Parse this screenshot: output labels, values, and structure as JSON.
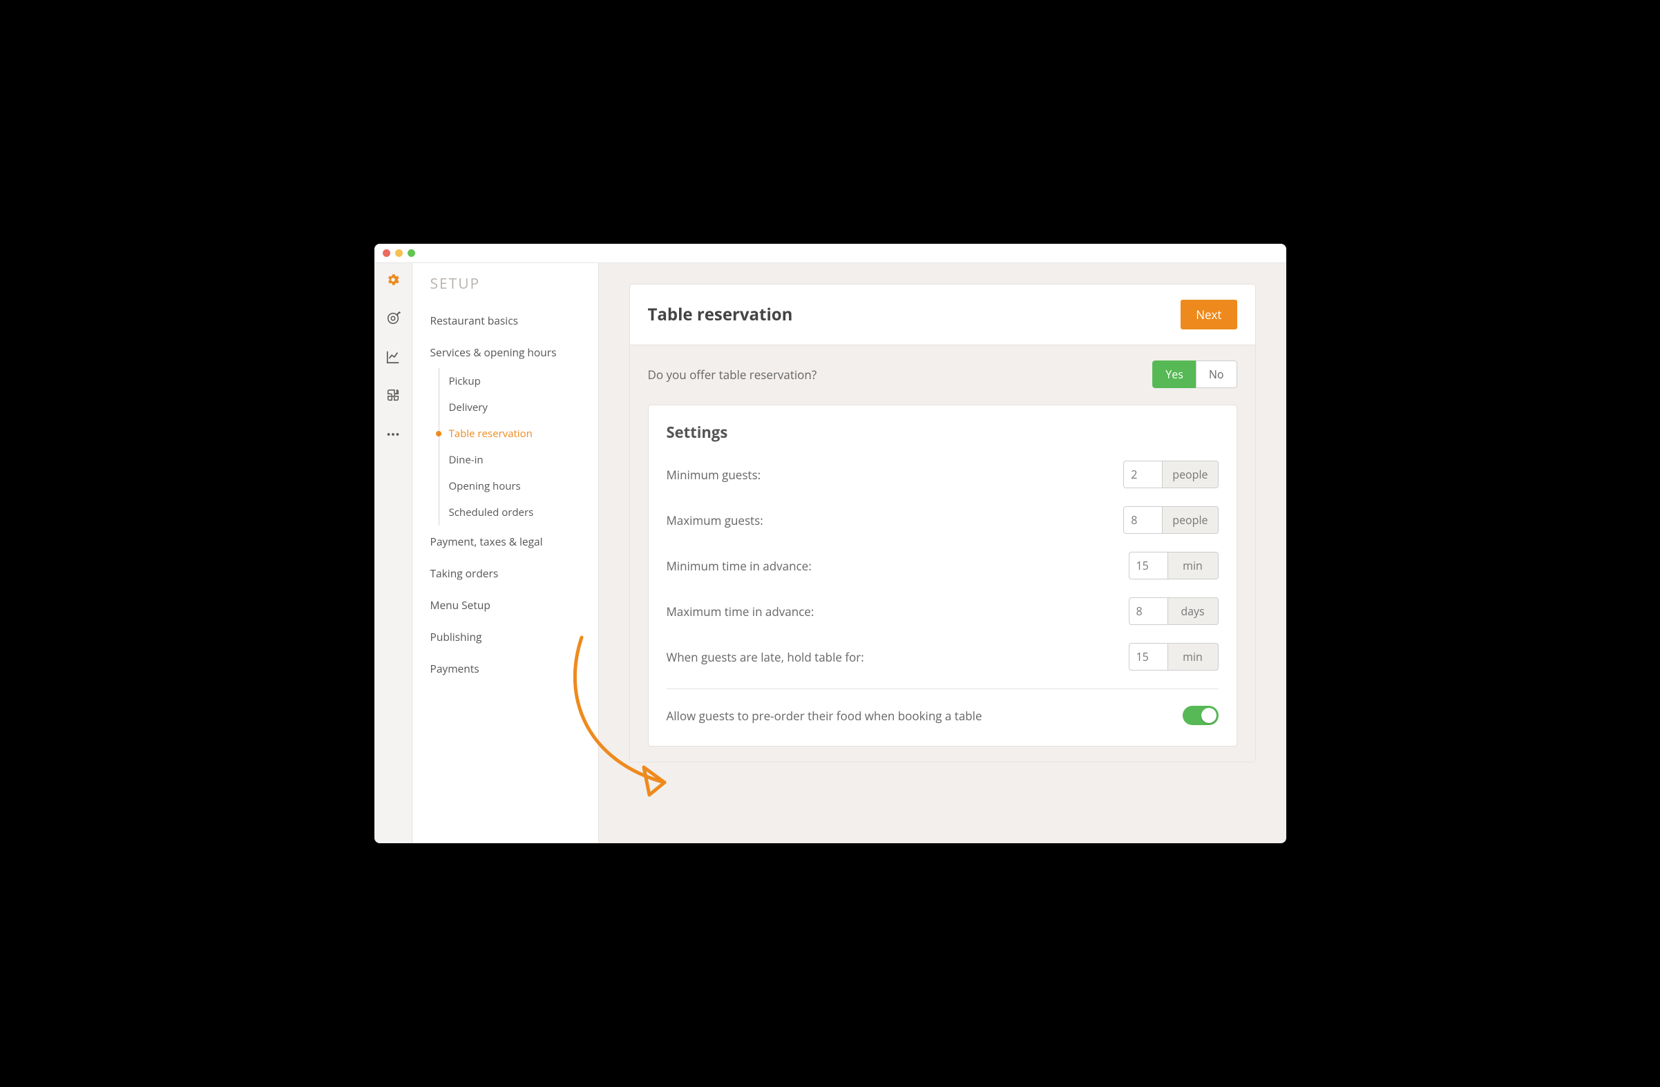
{
  "sidebar": {
    "title": "SETUP",
    "items": [
      {
        "label": "Restaurant basics"
      },
      {
        "label": "Services & opening hours",
        "children": [
          {
            "label": "Pickup"
          },
          {
            "label": "Delivery"
          },
          {
            "label": "Table reservation",
            "active": true
          },
          {
            "label": "Dine-in"
          },
          {
            "label": "Opening hours"
          },
          {
            "label": "Scheduled orders"
          }
        ]
      },
      {
        "label": "Payment, taxes & legal"
      },
      {
        "label": "Taking orders"
      },
      {
        "label": "Menu Setup"
      },
      {
        "label": "Publishing"
      },
      {
        "label": "Payments"
      }
    ]
  },
  "page": {
    "title": "Table reservation",
    "next_label": "Next",
    "question": "Do you offer table reservation?",
    "yes_label": "Yes",
    "no_label": "No",
    "settings_heading": "Settings",
    "fields": {
      "min_guests": {
        "label": "Minimum guests:",
        "value": "2",
        "unit": "people"
      },
      "max_guests": {
        "label": "Maximum guests:",
        "value": "8",
        "unit": "people"
      },
      "min_advance": {
        "label": "Minimum time in advance:",
        "value": "15",
        "unit": "min"
      },
      "max_advance": {
        "label": "Maximum time in advance:",
        "value": "8",
        "unit": "days"
      },
      "hold_table": {
        "label": "When guests are late, hold table for:",
        "value": "15",
        "unit": "min"
      }
    },
    "preorder_label": "Allow guests to pre-order their food when booking a table",
    "preorder_enabled": true
  },
  "colors": {
    "accent": "#ee8a1d",
    "success": "#57b955"
  }
}
